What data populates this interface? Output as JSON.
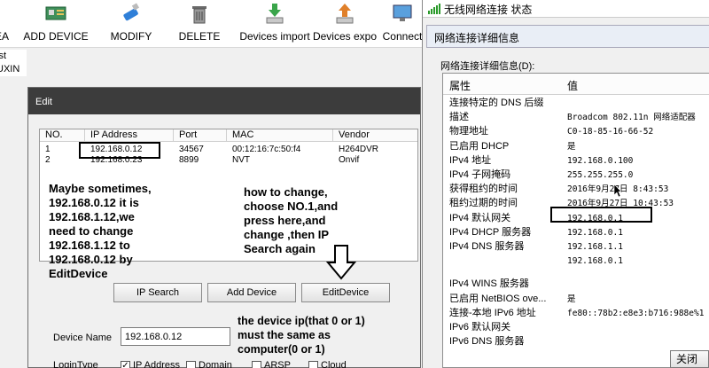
{
  "toolbar": {
    "items": [
      {
        "label": "EA",
        "icon": "partial-icon"
      },
      {
        "label": "ADD DEVICE",
        "icon": "device-board-icon"
      },
      {
        "label": "MODIFY",
        "icon": "usb-stick-icon"
      },
      {
        "label": "DELETE",
        "icon": "trash-icon"
      },
      {
        "label": "Devices import",
        "icon": "import-arrow-icon"
      },
      {
        "label": "Devices expo",
        "icon": "export-arrow-icon"
      },
      {
        "label": "Connect",
        "icon": "monitor-icon"
      }
    ]
  },
  "left_list": [
    "List",
    "UXIN"
  ],
  "edit_dialog": {
    "title": "Edit",
    "columns": [
      "NO.",
      "IP Address",
      "Port",
      "MAC",
      "Vendor"
    ],
    "rows": [
      {
        "no": "1",
        "ip": "192.168.0.12",
        "port": "34567",
        "mac": "00:12:16:7c:50:f4",
        "vendor": "H264DVR"
      },
      {
        "no": "2",
        "ip": "192.168.0.23",
        "port": "8899",
        "mac": "NVT",
        "vendor": "Onvif"
      }
    ],
    "buttons": {
      "ip_search": "IP Search",
      "add_device": "Add Device",
      "edit_device": "EditDevice"
    },
    "device_name_label": "Device Name",
    "device_name_value": "192.168.0.12",
    "login_type_label": "LoginType",
    "login_options": [
      {
        "label": "IP Address",
        "checked": true
      },
      {
        "label": "Domain",
        "checked": false
      },
      {
        "label": "ARSP",
        "checked": false
      },
      {
        "label": "Cloud",
        "checked": false
      }
    ]
  },
  "annotations": {
    "note1": [
      "Maybe sometimes,",
      "192.168.0.12 it is",
      "192.168.1.12,we",
      "need to change",
      "192.168.1.12 to",
      "192.168.0.12 by",
      "EditDevice"
    ],
    "note2": [
      "how to change,",
      "choose NO.1,and",
      "press here,and",
      "change ,then IP",
      "Search again"
    ],
    "note3": [
      "the device ip(that 0 or 1)",
      "must the same as",
      "computer(0 or 1)"
    ]
  },
  "net_window": {
    "status_title": "无线网络连接 状态",
    "caption": "网络连接详细信息",
    "list_label": "网络连接详细信息(D):",
    "col_property": "属性",
    "col_value": "值",
    "rows": [
      {
        "k": "连接特定的 DNS 后缀",
        "v": ""
      },
      {
        "k": "描述",
        "v": "Broadcom 802.11n 网络适配器"
      },
      {
        "k": "物理地址",
        "v": "C0-18-85-16-66-52"
      },
      {
        "k": "已启用 DHCP",
        "v": "是"
      },
      {
        "k": "IPv4 地址",
        "v": "192.168.0.100"
      },
      {
        "k": "IPv4 子网掩码",
        "v": "255.255.255.0"
      },
      {
        "k": "获得租约的时间",
        "v": "2016年9月27日 8:43:53"
      },
      {
        "k": "租约过期的时间",
        "v": "2016年9月27日 10:43:53"
      },
      {
        "k": "IPv4 默认网关",
        "v": "192.168.0.1"
      },
      {
        "k": "IPv4 DHCP 服务器",
        "v": "192.168.0.1"
      },
      {
        "k": "IPv4 DNS 服务器",
        "v": "192.168.1.1"
      },
      {
        "k": "",
        "v": "192.168.0.1"
      },
      {
        "k": "IPv4 WINS 服务器",
        "v": ""
      },
      {
        "k": "已启用 NetBIOS ove...",
        "v": "是"
      },
      {
        "k": "连接-本地 IPv6 地址",
        "v": "fe80::78b2:e8e3:b716:988e%1"
      },
      {
        "k": "IPv6 默认网关",
        "v": ""
      },
      {
        "k": "IPv6 DNS 服务器",
        "v": ""
      }
    ],
    "close_button": "关闭"
  },
  "colors": {
    "toolbar_bg": "#ffffff",
    "dialog_title_bg": "#3c3c3c",
    "window_bg": "#f0f0f0"
  }
}
